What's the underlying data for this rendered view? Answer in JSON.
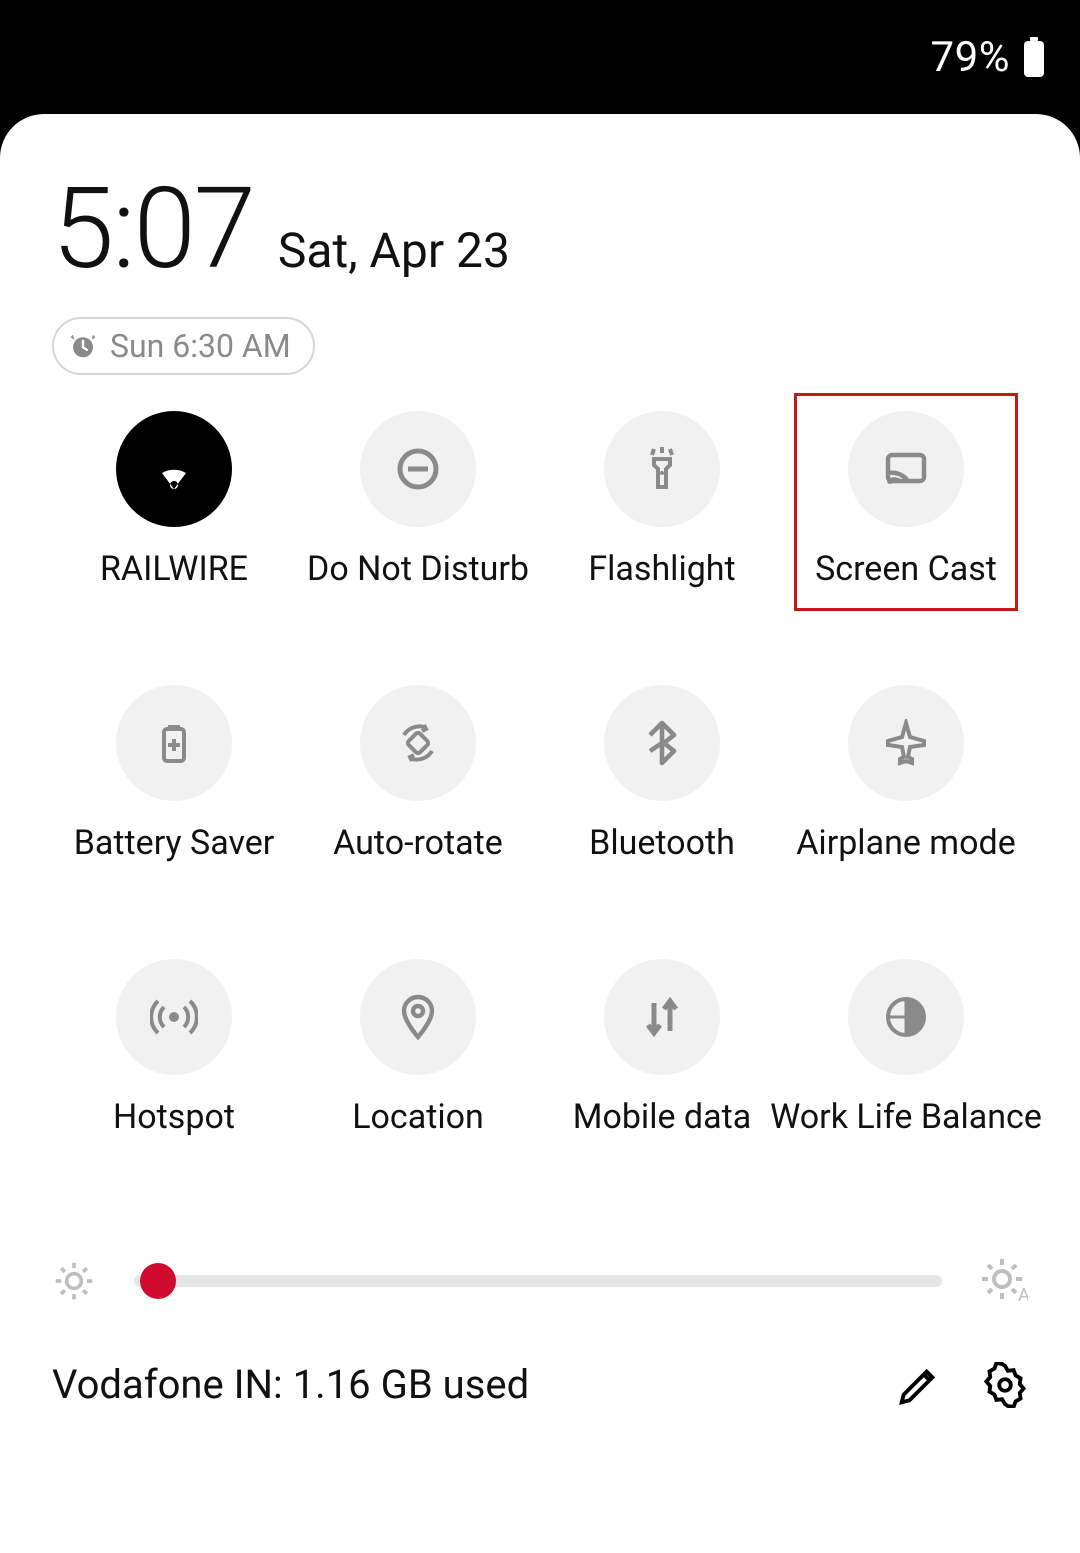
{
  "statusbar": {
    "battery_pct": "79%"
  },
  "header": {
    "time": "5:07",
    "date": "Sat, Apr 23",
    "alarm": "Sun 6:30 AM"
  },
  "tiles": [
    {
      "id": "wifi",
      "label": "RAILWIRE",
      "icon": "wifi",
      "active": true,
      "highlight": false
    },
    {
      "id": "dnd",
      "label": "Do Not Disturb",
      "icon": "dnd",
      "active": false,
      "highlight": false
    },
    {
      "id": "flashlight",
      "label": "Flashlight",
      "icon": "flashlight",
      "active": false,
      "highlight": false
    },
    {
      "id": "screen-cast",
      "label": "Screen Cast",
      "icon": "cast",
      "active": false,
      "highlight": true
    },
    {
      "id": "battery-saver",
      "label": "Battery Saver",
      "icon": "battery-plus",
      "active": false,
      "highlight": false
    },
    {
      "id": "auto-rotate",
      "label": "Auto-rotate",
      "icon": "rotate",
      "active": false,
      "highlight": false
    },
    {
      "id": "bluetooth",
      "label": "Bluetooth",
      "icon": "bluetooth",
      "active": false,
      "highlight": false
    },
    {
      "id": "airplane",
      "label": "Airplane mode",
      "icon": "airplane",
      "active": false,
      "highlight": false
    },
    {
      "id": "hotspot",
      "label": "Hotspot",
      "icon": "hotspot",
      "active": false,
      "highlight": false
    },
    {
      "id": "location",
      "label": "Location",
      "icon": "location",
      "active": false,
      "highlight": false
    },
    {
      "id": "mobile-data",
      "label": "Mobile data",
      "icon": "mobile-data",
      "active": false,
      "highlight": false
    },
    {
      "id": "work-life",
      "label": "Work Life Balance",
      "icon": "work-life",
      "active": false,
      "highlight": false
    }
  ],
  "brightness": {
    "percent": 3
  },
  "footer": {
    "usage_text": "Vodafone IN: 1.16 GB used"
  },
  "colors": {
    "accent_red": "#cf0a2c",
    "highlight_border": "#c41919",
    "tile_bg": "#f1f1f1",
    "tile_active_bg": "#000000",
    "icon_gray": "#8a8a8a"
  }
}
